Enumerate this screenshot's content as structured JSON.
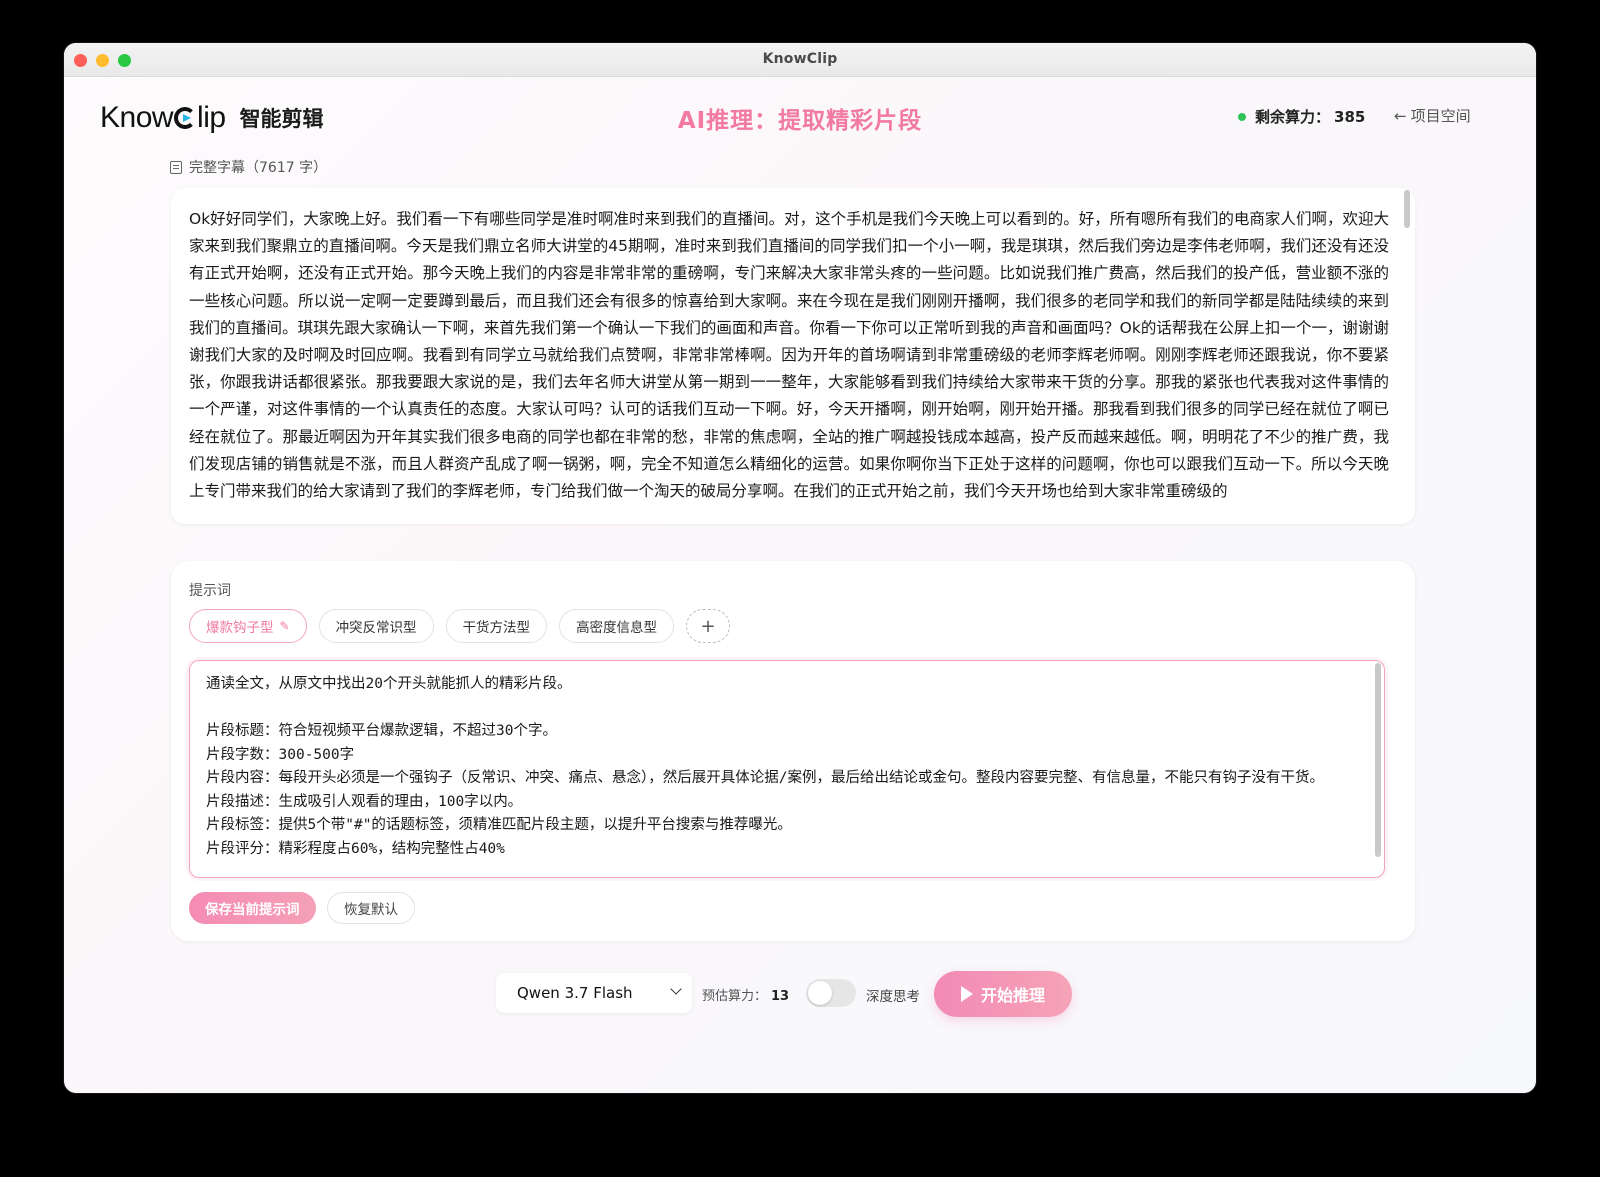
{
  "window": {
    "title": "KnowClip"
  },
  "header": {
    "logo_text_before": "Know",
    "logo_text_after": "lip",
    "logo_sub": "智能剪辑",
    "page_title": "AI推理：提取精彩片段",
    "credits_label": "剩余算力：",
    "credits_value": "385",
    "back_label": "项目空间"
  },
  "transcript": {
    "label": "完整字幕（7617 字）",
    "text": "Ok好好同学们，大家晚上好。我们看一下有哪些同学是准时啊准时来到我们的直播间。对，这个手机是我们今天晚上可以看到的。好，所有嗯所有我们的电商家人们啊，欢迎大家来到我们聚鼎立的直播间啊。今天是我们鼎立名师大讲堂的45期啊，准时来到我们直播间的同学我们扣一个小一啊，我是琪琪，然后我们旁边是李伟老师啊，我们还没有还没有正式开始啊，还没有正式开始。那今天晚上我们的内容是非常非常的重磅啊，专门来解决大家非常头疼的一些问题。比如说我们推广费高，然后我们的投产低，营业额不涨的一些核心问题。所以说一定啊一定要蹲到最后，而且我们还会有很多的惊喜给到大家啊。来在今现在是我们刚刚开播啊，我们很多的老同学和我们的新同学都是陆陆续续的来到我们的直播间。琪琪先跟大家确认一下啊，来首先我们第一个确认一下我们的画面和声音。你看一下你可以正常听到我的声音和画面吗？Ok的话帮我在公屏上扣一个一，谢谢谢谢我们大家的及时啊及时回应啊。我看到有同学立马就给我们点赞啊，非常非常棒啊。因为开年的首场啊请到非常重磅级的老师李辉老师啊。刚刚李辉老师还跟我说，你不要紧张，你跟我讲话都很紧张。那我要跟大家说的是，我们去年名师大讲堂从第一期到一一整年，大家能够看到我们持续给大家带来干货的分享。那我的紧张也代表我对这件事情的一个严谨，对这件事情的一个认真责任的态度。大家认可吗？认可的话我们互动一下啊。好，今天开播啊，刚开始啊，刚开始开播。那我看到我们很多的同学已经在就位了啊已经在就位了。那最近啊因为开年其实我们很多电商的同学也都在非常的愁，非常的焦虑啊，全站的推广啊越投钱成本越高，投产反而越来越低。啊，明明花了不少的推广费，我们发现店铺的销售就是不涨，而且人群资产乱成了啊一锅粥，啊，完全不知道怎么精细化的运营。如果你啊你当下正处于这样的问题啊，你也可以跟我们互动一下。所以今天晚上专门带来我们的给大家请到了我们的李辉老师，专门给我们做一个淘天的破局分享啊。在我们的正式开始之前，我们今天开场也给到大家非常重磅级的"
  },
  "prompt": {
    "label": "提示词",
    "chips": [
      "爆款钩子型",
      "冲突反常识型",
      "干货方法型",
      "高密度信息型"
    ],
    "add_label": "+",
    "text": "通读全文，从原文中找出20个开头就能抓人的精彩片段。\n\n片段标题：符合短视频平台爆款逻辑，不超过30个字。\n片段字数：300-500字\n片段内容：每段开头必须是一个强钩子（反常识、冲突、痛点、悬念），然后展开具体论据/案例，最后给出结论或金句。整段内容要完整、有信息量，不能只有钩子没有干货。\n片段描述：生成吸引人观看的理由，100字以内。\n片段标签：提供5个带\"#\"的话题标签，须精准匹配片段主题，以提升平台搜索与推荐曝光。\n片段评分：精彩程度占60%，结构完整性占40%",
    "save_label": "保存当前提示词",
    "reset_label": "恢复默认"
  },
  "footer": {
    "model": "Qwen 3.7 Flash",
    "est_label": "预估算力：",
    "est_value": "13",
    "deep_label": "深度思考",
    "start_label": "开始推理"
  },
  "colors": {
    "accent_pink": "#f27aa2",
    "status_green": "#2ec45a"
  }
}
